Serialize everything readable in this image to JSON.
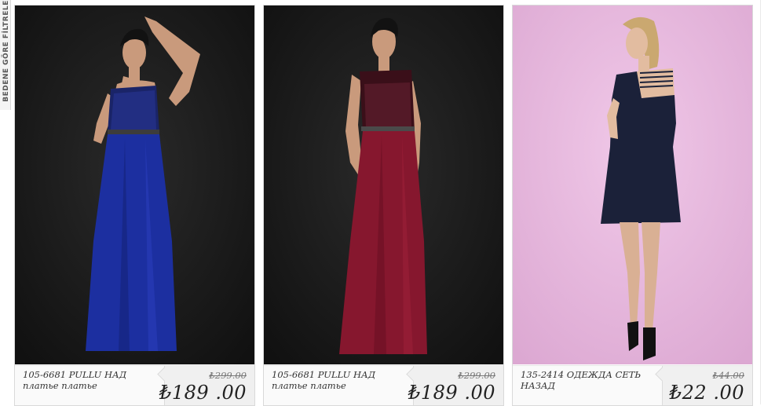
{
  "side_tab": {
    "label": "BEDENE GÖRE FİLTRELE"
  },
  "products": [
    {
      "name": "105-6681 PULLU НАД платье платье",
      "old_price": "₺299.00",
      "price": "₺189 .00",
      "dress_color": "#1c2fa0",
      "bodice_color": "#1a2468",
      "background": "#1b1b1b"
    },
    {
      "name": "105-6681 PULLU НАД платье платье",
      "old_price": "₺299.00",
      "price": "₺189 .00",
      "dress_color": "#86172e",
      "bodice_color": "#3a0f19",
      "background": "#1b1b1b"
    },
    {
      "name": "135-2414 ОДЕЖДА СЕТЬ НАЗАД",
      "old_price": "₺44.00",
      "price": "₺22 .00",
      "dress_color": "#1b2139",
      "bodice_color": "#1b2139",
      "background": "#e7b7dc"
    }
  ]
}
